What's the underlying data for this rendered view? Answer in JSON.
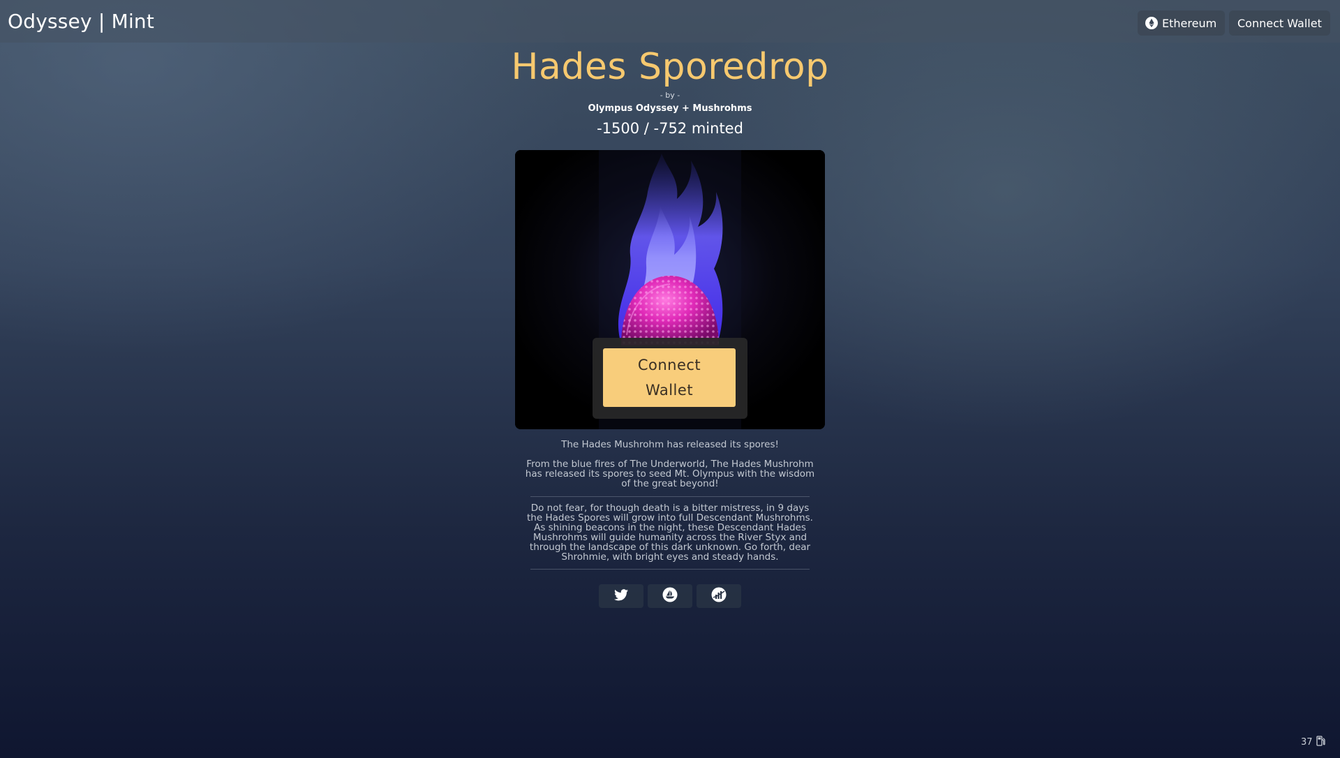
{
  "header": {
    "brand": "Odyssey | Mint",
    "network_label": "Ethereum",
    "network_icon": "ethereum-icon",
    "connect_label": "Connect Wallet"
  },
  "drop": {
    "title": "Hades Sporedrop",
    "by_label": "- by -",
    "creator": "Olympus Odyssey + Mushrohms",
    "minted_text": "-1500 / -752 minted"
  },
  "artwork": {
    "subject": "glowing pink mushroom cap engulfed in blue flames",
    "connect_line1": "Connect",
    "connect_line2": "Wallet"
  },
  "description": {
    "p1": "The Hades Mushrohm has released its spores!",
    "p2": "From the blue fires of The Underworld, The Hades Mushrohm has released its spores to seed Mt. Olympus with the wisdom of the great beyond!",
    "p3": "Do not fear, for though death is a bitter mistress, in 9 days the Hades Spores will grow into full Descendant Mushrohms. As shining beacons in the night, these Descendant Hades Mushrohms will guide humanity across the River Styx and through the landscape of this dark unknown. Go forth, dear Shrohmie, with bright eyes and steady hands."
  },
  "socials": [
    {
      "icon": "twitter-icon"
    },
    {
      "icon": "opensea-icon"
    },
    {
      "icon": "chart-icon"
    }
  ],
  "footer": {
    "block_number": "37",
    "gas_icon": "gas-pump-icon"
  },
  "colors": {
    "accent": "#f7c96f",
    "button_fill": "#f8cd7b"
  }
}
